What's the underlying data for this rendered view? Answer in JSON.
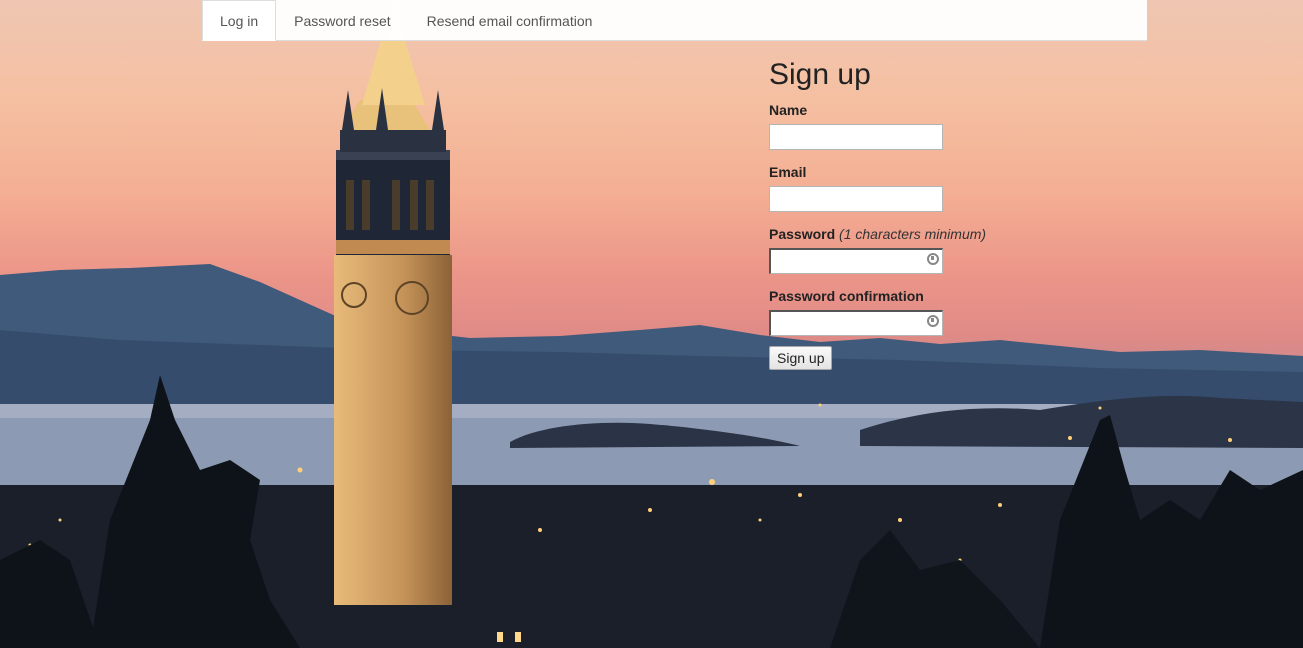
{
  "nav": {
    "tabs": [
      {
        "label": "Log in",
        "active": true
      },
      {
        "label": "Password reset",
        "active": false
      },
      {
        "label": "Resend email confirmation",
        "active": false
      }
    ]
  },
  "signup": {
    "title": "Sign up",
    "name_label": "Name",
    "name_value": "",
    "email_label": "Email",
    "email_value": "",
    "password_label": "Password",
    "password_hint": "(1 characters minimum)",
    "password_value": "",
    "password_confirmation_label": "Password confirmation",
    "password_confirmation_value": "",
    "submit_label": "Sign up"
  },
  "colors": {
    "tab_text": "#555555",
    "heading_text": "#222222",
    "sky_top": "#efc6b2",
    "sky_mid": "#ec9689"
  },
  "icons": {
    "password_field_icon": "key-icon"
  }
}
